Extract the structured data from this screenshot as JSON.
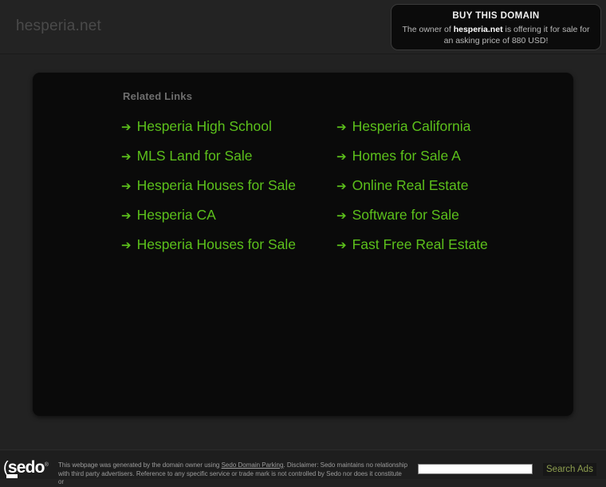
{
  "header": {
    "domain": "hesperia.net"
  },
  "buy_box": {
    "title": "BUY THIS DOMAIN",
    "desc_before": "The owner of ",
    "desc_domain": "hesperia.net",
    "desc_after": " is offering it for sale for an asking price of 880 USD!"
  },
  "main": {
    "related_label": "Related Links",
    "arrow_icon": "arrow-right-icon",
    "arrow_glyph": "➔",
    "links": [
      {
        "left": "Hesperia High School",
        "right": "Hesperia California"
      },
      {
        "left": "MLS Land for Sale",
        "right": "Homes for Sale A"
      },
      {
        "left": "Hesperia Houses for Sale",
        "right": "Online Real Estate"
      },
      {
        "left": "Hesperia CA",
        "right": "Software for Sale"
      },
      {
        "left": "Hesperia Houses for Sale",
        "right": "Fast Free Real Estate"
      }
    ]
  },
  "footer": {
    "logo_paren": "(",
    "logo_text": "sedo",
    "logo_reg": "®",
    "disclaimer_1": "This webpage was generated by the domain owner using ",
    "disclaimer_link": "Sedo Domain Parking",
    "disclaimer_2": ". Disclaimer: Sedo maintains no relationship with third party advertisers. Reference to any specific service or trade mark is not controlled by Sedo nor does it constitute or",
    "search_value": "",
    "search_placeholder": "",
    "search_button": "Search Ads"
  },
  "colors": {
    "link_green": "#5cc01b",
    "page_bg": "#222222",
    "panel_bg": "#0a0a0a",
    "button_green": "#8e9e4f"
  }
}
